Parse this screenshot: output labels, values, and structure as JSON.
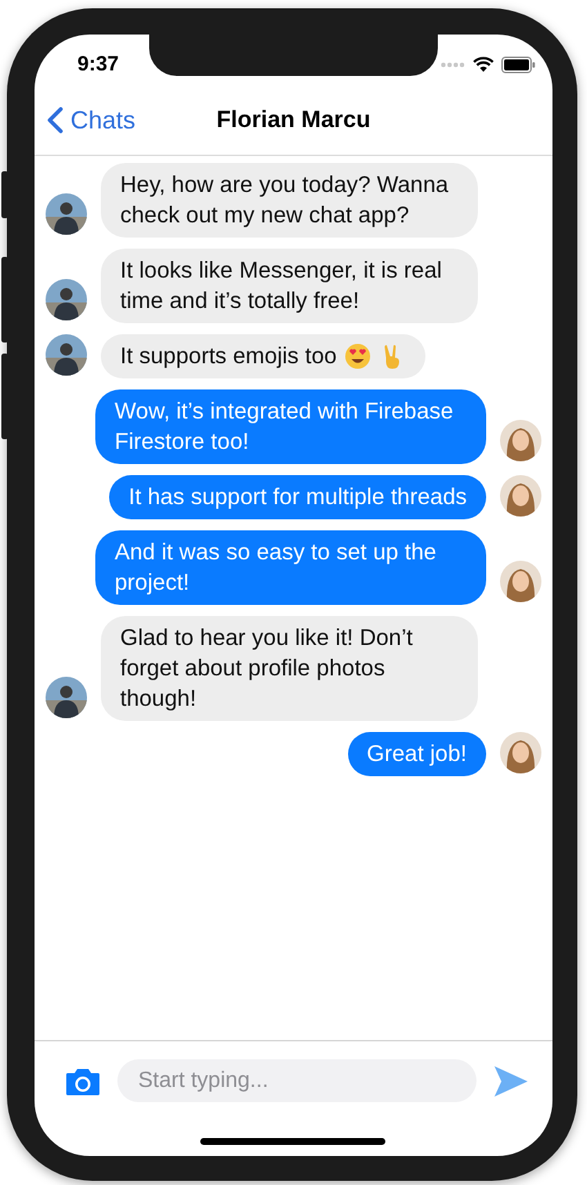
{
  "status_bar": {
    "time": "9:37"
  },
  "nav": {
    "back": "Chats",
    "title": "Florian Marcu"
  },
  "messages": [
    {
      "kind": "incoming",
      "text": "Hey, how are you today? Wanna check out my new chat app?"
    },
    {
      "kind": "incoming",
      "text": "It looks like Messenger, it is real time and it’s totally free!"
    },
    {
      "kind": "incoming",
      "text": "It supports emojis too",
      "emojis": true
    },
    {
      "kind": "outgoing",
      "text": "Wow, it’s integrated with Firebase Firestore too!"
    },
    {
      "kind": "outgoing",
      "text": "It has support for multiple threads"
    },
    {
      "kind": "outgoing",
      "text": "And it was so easy to set up the project!"
    },
    {
      "kind": "incoming",
      "text": "Glad to hear you like it! Don’t forget about profile photos though!"
    },
    {
      "kind": "outgoing",
      "text": "Great job!"
    }
  ],
  "composer": {
    "placeholder": "Start typing..."
  }
}
